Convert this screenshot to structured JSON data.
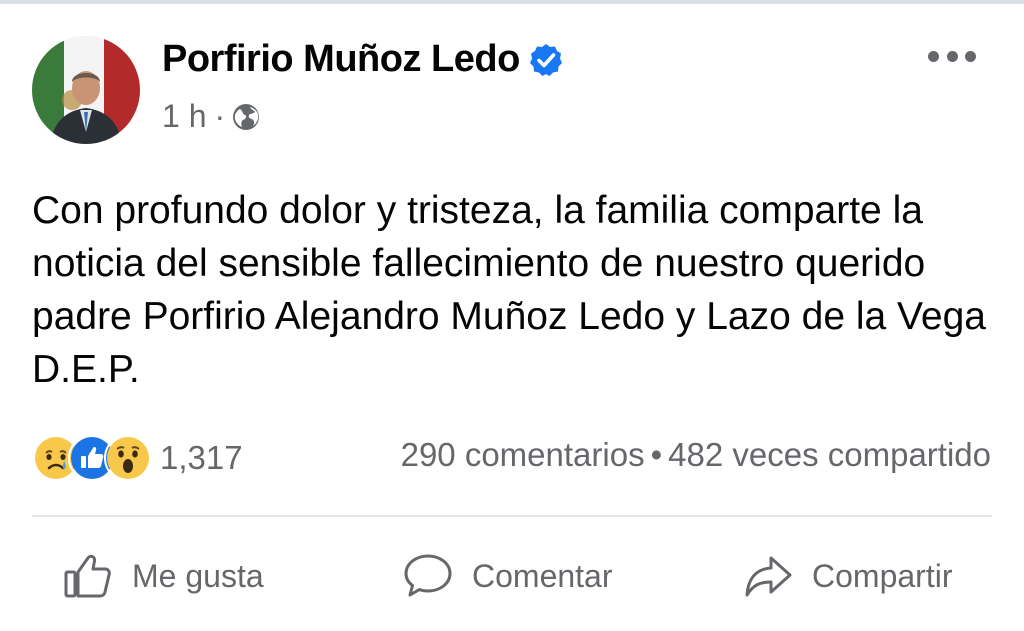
{
  "post": {
    "author": "Porfirio Muñoz Ledo",
    "time": "1 h",
    "separator": "·",
    "text": "Con profundo dolor y tristeza, la familia comparte la noticia del sensible fallecimiento de nuestro querido padre Porfirio Alejandro Muñoz Ledo y Lazo de la Vega D.E.P.",
    "reactions": {
      "icons": [
        "sad-icon",
        "like-icon",
        "wow-icon"
      ],
      "count": "1,317"
    },
    "comments": "290 comentarios",
    "dot": "•",
    "shares": "482 veces compartido"
  },
  "actions": {
    "like": "Me gusta",
    "comment": "Comentar",
    "share": "Compartir"
  },
  "colors": {
    "verified": "#1877f2",
    "like_blue": "#1b74e4",
    "reaction_yellow": "#f7c84a",
    "muted_text": "#65676b"
  }
}
